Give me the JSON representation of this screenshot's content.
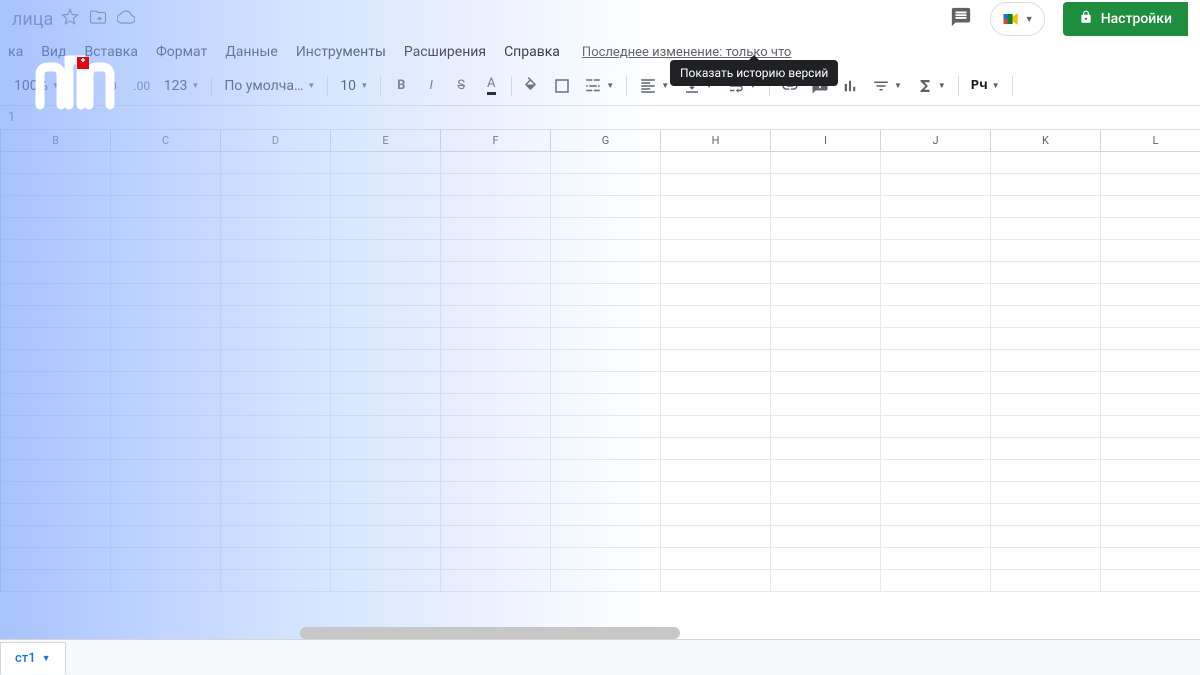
{
  "title": {
    "doc_name_suffix": "лица"
  },
  "header": {
    "share_label": "Настройки"
  },
  "menu": {
    "items": [
      "ка",
      "Вид",
      "Вставка",
      "Формат",
      "Данные",
      "Инструменты",
      "Расширения",
      "Справка"
    ],
    "last_edit": "Последнее изменение: только что",
    "tooltip": "Показать историю версий"
  },
  "toolbar": {
    "zoom": "100%",
    "percent": "%",
    "dec0": ".0",
    "dec00": ".00",
    "num_fmt": "123",
    "font": "По умолча…",
    "size": "10",
    "bold": "B",
    "italic": "I",
    "strike": "S",
    "textcolor": "A",
    "pylabel": "Pч"
  },
  "formula": {
    "cell_ref": "1"
  },
  "columns": [
    "B",
    "C",
    "D",
    "E",
    "F",
    "G",
    "H",
    "I",
    "J",
    "K",
    "L"
  ],
  "rows": 20,
  "sheets": {
    "tab1": "ст1"
  }
}
